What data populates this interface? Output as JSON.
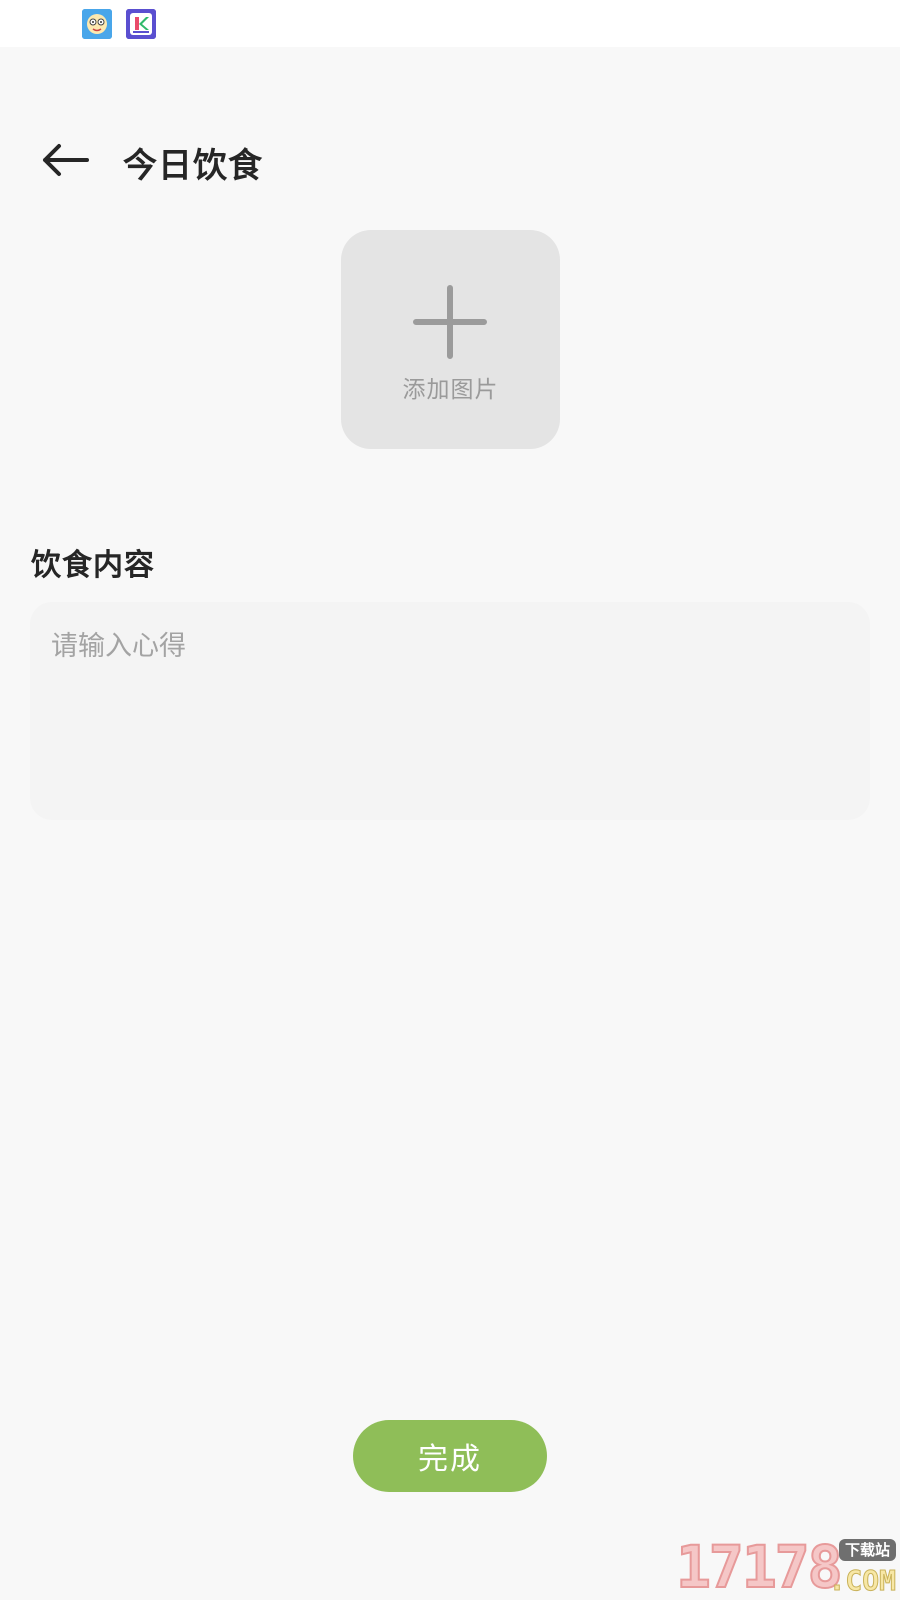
{
  "status_bar": {
    "app_icons": [
      "cartoon-face-icon",
      "k-app-icon"
    ]
  },
  "header": {
    "back_icon": "arrow-left-icon",
    "title": "今日饮食"
  },
  "image_picker": {
    "icon": "plus-icon",
    "label": "添加图片"
  },
  "content_section": {
    "label": "饮食内容",
    "input_value": "",
    "input_placeholder": "请输入心得"
  },
  "footer": {
    "done_label": "完成"
  },
  "watermark": {
    "digits": "17178",
    "badge": "下载站",
    "suffix": ".COM"
  },
  "colors": {
    "background": "#f8f8f8",
    "accent_green": "#8fbe58",
    "title_text": "#262626",
    "placeholder_gray": "#a3a3a3",
    "tile_gray": "#e4e4e4"
  }
}
